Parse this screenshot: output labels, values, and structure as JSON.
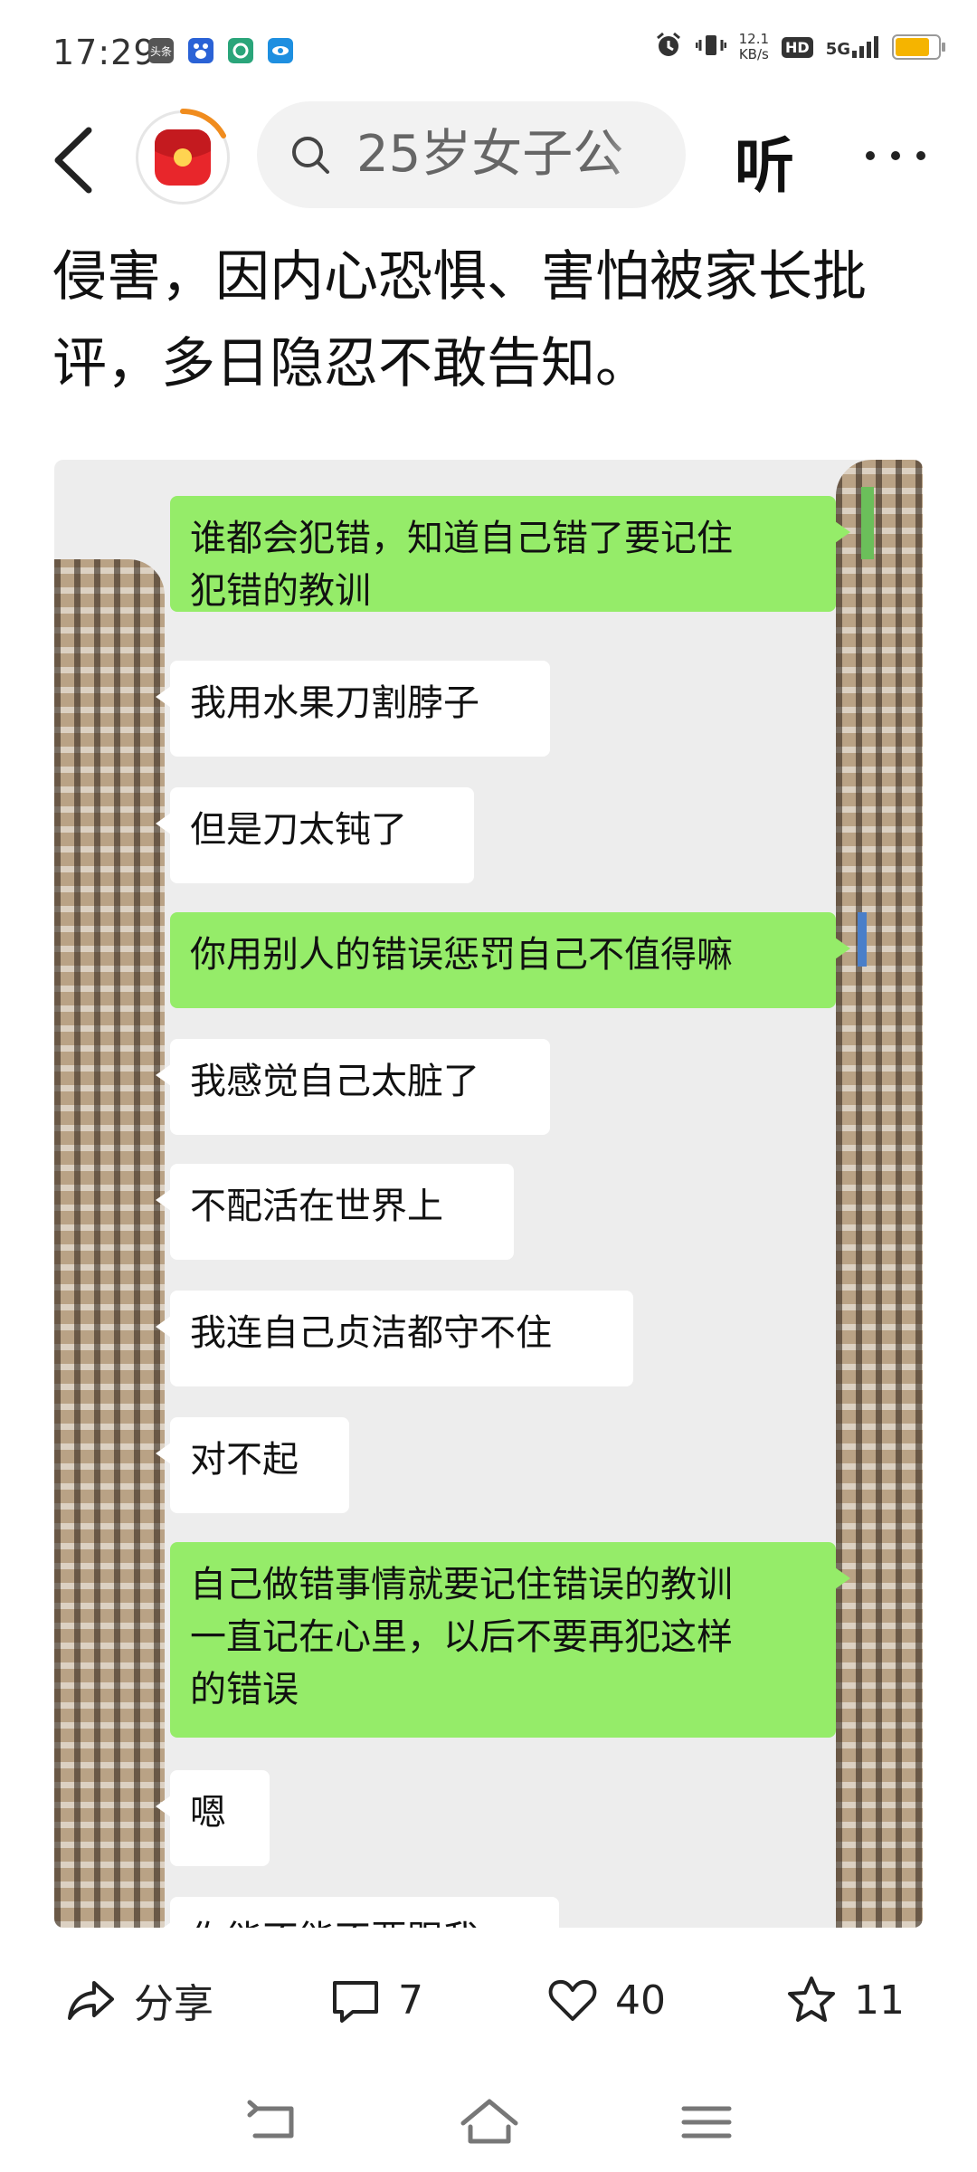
{
  "status_bar": {
    "time": "17:29",
    "app_icons": [
      "toutiao-icon",
      "baidu-icon",
      "mobile-icon",
      "qq-browser-icon"
    ],
    "app_icon_label": "头条",
    "net_speed_value": "12.1",
    "net_speed_unit": "KB/s",
    "hd": "HD",
    "signal": "5G",
    "battery_color": "#f5b400",
    "battery_level": 0.85
  },
  "top_bar": {
    "search_text": "25岁女子公",
    "listen_label": "听"
  },
  "article": {
    "lines": [
      "侵害，因内心恐惧、害怕被家长批",
      "评，多日隐忍不敢告知。"
    ]
  },
  "chat": {
    "messages": [
      {
        "side": "self",
        "text": "谁都会犯错，知道自己错了要记住\n犯错的教训"
      },
      {
        "side": "other",
        "text": "我用水果刀割脖子"
      },
      {
        "side": "other",
        "text": "但是刀太钝了"
      },
      {
        "side": "self",
        "text": "你用别人的错误惩罚自己不值得嘛"
      },
      {
        "side": "other",
        "text": "我感觉自己太脏了"
      },
      {
        "side": "other",
        "text": "不配活在世界上"
      },
      {
        "side": "other",
        "text": "我连自己贞洁都守不住"
      },
      {
        "side": "other",
        "text": "对不起"
      },
      {
        "side": "self",
        "text": "自己做错事情就要记住错误的教训\n一直记在心里，以后不要再犯这样\n的错误"
      },
      {
        "side": "other",
        "text": "嗯"
      },
      {
        "side": "other",
        "text": "你能不能不要跟我"
      }
    ],
    "self_bubble_color": "#95ec69",
    "other_bubble_color": "#ffffff"
  },
  "actions": {
    "share_label": "分享",
    "comment_count": "7",
    "like_count": "40",
    "favorite_count": "11"
  },
  "nav": {
    "buttons": [
      "back-nav-icon",
      "home-nav-icon",
      "menu-nav-icon"
    ]
  }
}
